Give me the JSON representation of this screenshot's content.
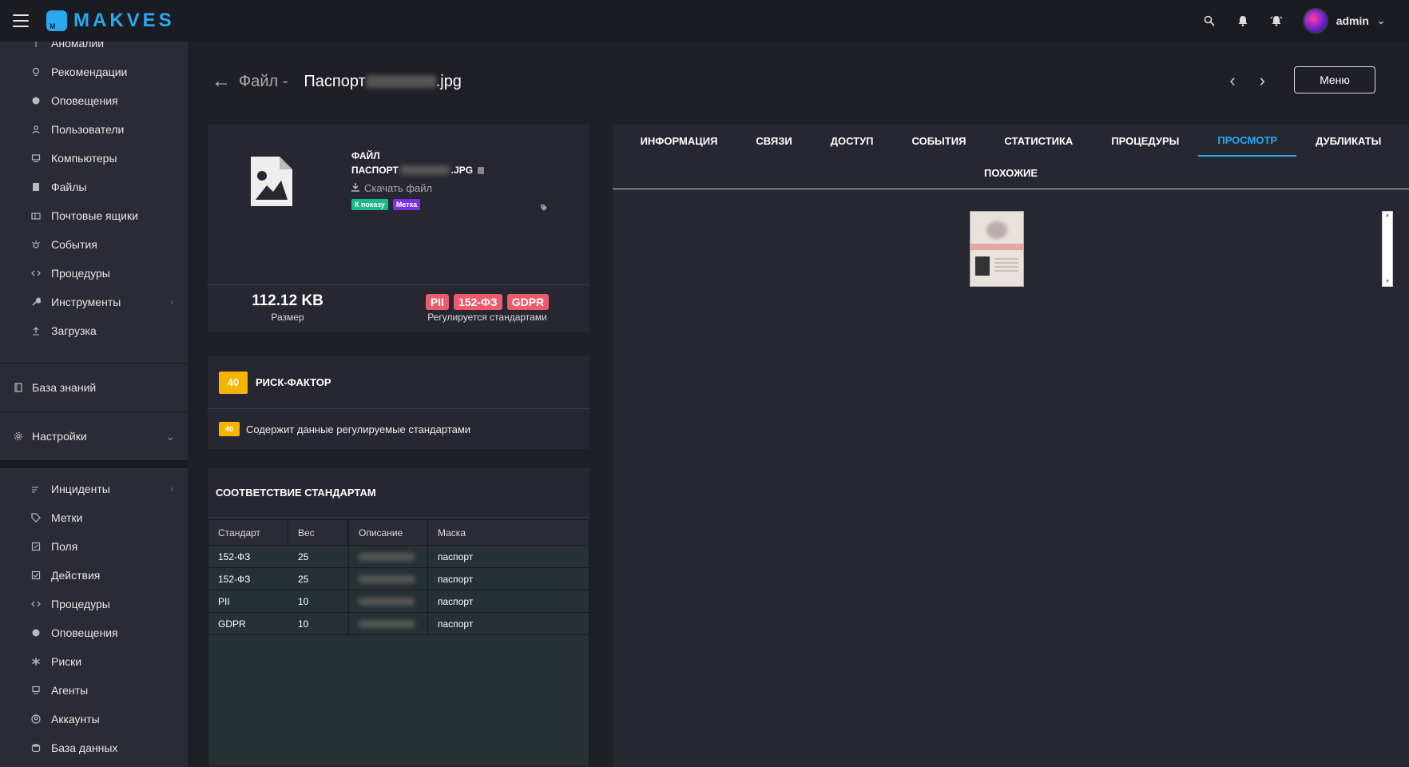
{
  "app": {
    "brand": "MAKVES",
    "user": "admin"
  },
  "sidebar": {
    "items_top": [
      {
        "label": "Аномалии",
        "icon": "anomaly-icon"
      },
      {
        "label": "Рекомендации",
        "icon": "bulb-icon"
      },
      {
        "label": "Оповещения",
        "icon": "alert-icon"
      },
      {
        "label": "Пользователи",
        "icon": "user-icon"
      },
      {
        "label": "Компьютеры",
        "icon": "computer-icon"
      },
      {
        "label": "Файлы",
        "icon": "file-icon"
      },
      {
        "label": "Почтовые ящики",
        "icon": "mailbox-icon"
      },
      {
        "label": "События",
        "icon": "event-icon"
      },
      {
        "label": "Процедуры",
        "icon": "code-icon"
      },
      {
        "label": "Инструменты",
        "icon": "wrench-icon"
      },
      {
        "label": "Загрузка",
        "icon": "upload-icon"
      }
    ],
    "knowledge": "База знаний",
    "settings": "Настройки",
    "items_settings": [
      {
        "label": "Инциденты",
        "icon": "incident-icon"
      },
      {
        "label": "Метки",
        "icon": "tag-icon"
      },
      {
        "label": "Поля",
        "icon": "field-icon"
      },
      {
        "label": "Действия",
        "icon": "action-icon"
      },
      {
        "label": "Процедуры",
        "icon": "code-icon"
      },
      {
        "label": "Оповещения",
        "icon": "alert-icon"
      },
      {
        "label": "Риски",
        "icon": "asterisk-icon"
      },
      {
        "label": "Агенты",
        "icon": "agent-icon"
      },
      {
        "label": "Аккаунты",
        "icon": "account-icon"
      },
      {
        "label": "База данных",
        "icon": "database-icon"
      }
    ]
  },
  "header": {
    "prefix": "Файл -",
    "title_start": "Паспорт",
    "title_end": ".jpg",
    "menu": "Меню"
  },
  "file": {
    "type": "ФАЙЛ",
    "name_start": "ПАСПОРТ",
    "name_end": ".JPG",
    "download": "Скачать файл",
    "tags": [
      {
        "label": "К показу",
        "color": "#1bb98a"
      },
      {
        "label": "Метка",
        "color": "#7b2fe0"
      }
    ],
    "size": "112.12 KB",
    "size_label": "Размер",
    "standards": [
      "PII",
      "152-ФЗ",
      "GDPR"
    ],
    "standards_label": "Регулируется стандартами"
  },
  "risk": {
    "score": "40",
    "title": "РИСК-ФАКТОР",
    "item_score": "40",
    "item_text": "Содержит данные регулируемые стандартами"
  },
  "compliance": {
    "title": "СООТВЕТСТВИЕ СТАНДАРТАМ",
    "headers": [
      "Стандарт",
      "Вес",
      "Описание",
      "Маска"
    ],
    "rows": [
      {
        "standard": "152-ФЗ",
        "weight": "25",
        "mask": "паспорт"
      },
      {
        "standard": "152-ФЗ",
        "weight": "25",
        "mask": "паспорт"
      },
      {
        "standard": "PII",
        "weight": "10",
        "mask": "паспорт"
      },
      {
        "standard": "GDPR",
        "weight": "10",
        "mask": "паспорт"
      }
    ]
  },
  "tabs": [
    "ИНФОРМАЦИЯ",
    "СВЯЗИ",
    "ДОСТУП",
    "СОБЫТИЯ",
    "СТАТИСТИКА",
    "ПРОЦЕДУРЫ",
    "ПРОСМОТР",
    "ДУБЛИКАТЫ",
    "ПОХОЖИЕ"
  ],
  "active_tab": "ПРОСМОТР"
}
